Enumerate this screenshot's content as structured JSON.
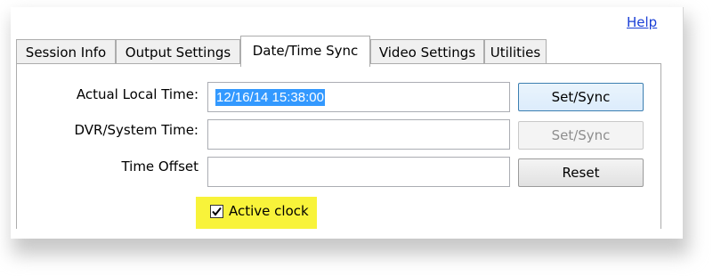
{
  "help_link": "Help",
  "tabs": [
    {
      "label": "Session Info"
    },
    {
      "label": "Output Settings"
    },
    {
      "label": "Date/Time Sync"
    },
    {
      "label": "Video Settings"
    },
    {
      "label": "Utilities"
    }
  ],
  "active_tab": "Date/Time Sync",
  "fields": {
    "actual_local_time": {
      "label": "Actual Local Time:",
      "value": "12/16/14 15:38:00"
    },
    "dvr_system_time": {
      "label": "DVR/System Time:",
      "value": ""
    },
    "time_offset": {
      "label": "Time Offset",
      "value": ""
    }
  },
  "buttons": {
    "set_sync_primary": "Set/Sync",
    "set_sync_disabled": "Set/Sync",
    "reset": "Reset"
  },
  "active_clock": {
    "label": "Active clock",
    "checked": true
  },
  "colors": {
    "highlight": "#f8f33a",
    "selection": "#3399ff",
    "link": "#1a3fd6"
  }
}
